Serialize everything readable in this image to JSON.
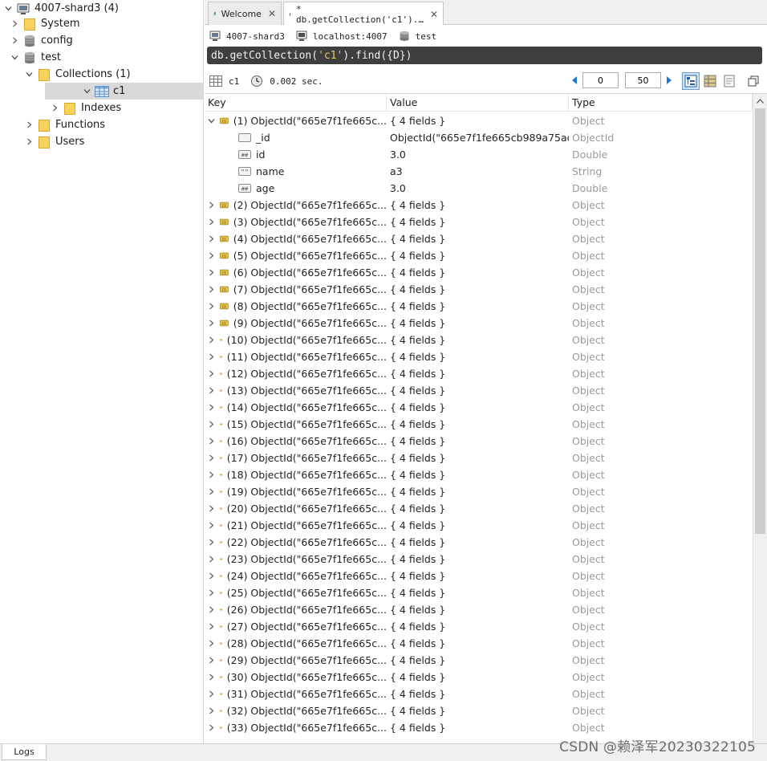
{
  "sidebar": {
    "items": [
      {
        "label": "4007-shard3 (4)",
        "icon": "server-icon",
        "expanded": true,
        "level": 0
      },
      {
        "label": "System",
        "icon": "folder-icon",
        "expanded": false,
        "level": 1
      },
      {
        "label": "config",
        "icon": "database-icon",
        "expanded": false,
        "level": 1
      },
      {
        "label": "test",
        "icon": "database-icon",
        "expanded": true,
        "level": 1
      },
      {
        "label": "Collections (1)",
        "icon": "folder-icon",
        "expanded": true,
        "level": 2
      },
      {
        "label": "c1",
        "icon": "collection-icon",
        "expanded": true,
        "level": 3,
        "selected": true
      },
      {
        "label": "Indexes",
        "icon": "folder-icon",
        "expanded": false,
        "level": 4
      },
      {
        "label": "Functions",
        "icon": "folder-icon",
        "expanded": false,
        "level": 2
      },
      {
        "label": "Users",
        "icon": "folder-icon",
        "expanded": false,
        "level": 2
      }
    ]
  },
  "tabs": [
    {
      "label": "Welcome",
      "active": false
    },
    {
      "label": "* db.getCollection('c1').…",
      "active": true
    }
  ],
  "connection": {
    "server": "4007-shard3",
    "host": "localhost:4007",
    "database": "test"
  },
  "query": {
    "prefix": "db.getCollection(",
    "arg": "'c1'",
    "suffix": ").find({D})"
  },
  "result_toolbar": {
    "collection": "c1",
    "time": "0.002 sec.",
    "skip": "0",
    "limit": "50"
  },
  "grid": {
    "headers": {
      "key": "Key",
      "value": "Value",
      "type": "Type"
    },
    "expanded_doc": {
      "key": "(1) ObjectId(\"665e7f1fe665c...",
      "value": "{ 4 fields }",
      "type": "Object",
      "fields": [
        {
          "key": "_id",
          "value": "ObjectId(\"665e7f1fe665cb989a75ad...",
          "type": "ObjectId",
          "icon": "objectid-icon"
        },
        {
          "key": "id",
          "value": "3.0",
          "type": "Double",
          "icon": "number-icon"
        },
        {
          "key": "name",
          "value": "a3",
          "type": "String",
          "icon": "string-icon"
        },
        {
          "key": "age",
          "value": "3.0",
          "type": "Double",
          "icon": "number-icon"
        }
      ]
    },
    "collapsed_docs": [
      {
        "key": "(2) ObjectId(\"665e7f1fe665c...",
        "value": "{ 4 fields }",
        "type": "Object"
      },
      {
        "key": "(3) ObjectId(\"665e7f1fe665c...",
        "value": "{ 4 fields }",
        "type": "Object"
      },
      {
        "key": "(4) ObjectId(\"665e7f1fe665c...",
        "value": "{ 4 fields }",
        "type": "Object"
      },
      {
        "key": "(5) ObjectId(\"665e7f1fe665c...",
        "value": "{ 4 fields }",
        "type": "Object"
      },
      {
        "key": "(6) ObjectId(\"665e7f1fe665c...",
        "value": "{ 4 fields }",
        "type": "Object"
      },
      {
        "key": "(7) ObjectId(\"665e7f1fe665c...",
        "value": "{ 4 fields }",
        "type": "Object"
      },
      {
        "key": "(8) ObjectId(\"665e7f1fe665c...",
        "value": "{ 4 fields }",
        "type": "Object"
      },
      {
        "key": "(9) ObjectId(\"665e7f1fe665c...",
        "value": "{ 4 fields }",
        "type": "Object"
      },
      {
        "key": "(10) ObjectId(\"665e7f1fe665c...",
        "value": "{ 4 fields }",
        "type": "Object"
      },
      {
        "key": "(11) ObjectId(\"665e7f1fe665c...",
        "value": "{ 4 fields }",
        "type": "Object"
      },
      {
        "key": "(12) ObjectId(\"665e7f1fe665c...",
        "value": "{ 4 fields }",
        "type": "Object"
      },
      {
        "key": "(13) ObjectId(\"665e7f1fe665c...",
        "value": "{ 4 fields }",
        "type": "Object"
      },
      {
        "key": "(14) ObjectId(\"665e7f1fe665c...",
        "value": "{ 4 fields }",
        "type": "Object"
      },
      {
        "key": "(15) ObjectId(\"665e7f1fe665c...",
        "value": "{ 4 fields }",
        "type": "Object"
      },
      {
        "key": "(16) ObjectId(\"665e7f1fe665c...",
        "value": "{ 4 fields }",
        "type": "Object"
      },
      {
        "key": "(17) ObjectId(\"665e7f1fe665c...",
        "value": "{ 4 fields }",
        "type": "Object"
      },
      {
        "key": "(18) ObjectId(\"665e7f1fe665c...",
        "value": "{ 4 fields }",
        "type": "Object"
      },
      {
        "key": "(19) ObjectId(\"665e7f1fe665c...",
        "value": "{ 4 fields }",
        "type": "Object"
      },
      {
        "key": "(20) ObjectId(\"665e7f1fe665c...",
        "value": "{ 4 fields }",
        "type": "Object"
      },
      {
        "key": "(21) ObjectId(\"665e7f1fe665c...",
        "value": "{ 4 fields }",
        "type": "Object"
      },
      {
        "key": "(22) ObjectId(\"665e7f1fe665c...",
        "value": "{ 4 fields }",
        "type": "Object"
      },
      {
        "key": "(23) ObjectId(\"665e7f1fe665c...",
        "value": "{ 4 fields }",
        "type": "Object"
      },
      {
        "key": "(24) ObjectId(\"665e7f1fe665c...",
        "value": "{ 4 fields }",
        "type": "Object"
      },
      {
        "key": "(25) ObjectId(\"665e7f1fe665c...",
        "value": "{ 4 fields }",
        "type": "Object"
      },
      {
        "key": "(26) ObjectId(\"665e7f1fe665c...",
        "value": "{ 4 fields }",
        "type": "Object"
      },
      {
        "key": "(27) ObjectId(\"665e7f1fe665c...",
        "value": "{ 4 fields }",
        "type": "Object"
      },
      {
        "key": "(28) ObjectId(\"665e7f1fe665c...",
        "value": "{ 4 fields }",
        "type": "Object"
      },
      {
        "key": "(29) ObjectId(\"665e7f1fe665c...",
        "value": "{ 4 fields }",
        "type": "Object"
      },
      {
        "key": "(30) ObjectId(\"665e7f1fe665c...",
        "value": "{ 4 fields }",
        "type": "Object"
      },
      {
        "key": "(31) ObjectId(\"665e7f1fe665c...",
        "value": "{ 4 fields }",
        "type": "Object"
      },
      {
        "key": "(32) ObjectId(\"665e7f1fe665c...",
        "value": "{ 4 fields }",
        "type": "Object"
      },
      {
        "key": "(33) ObjectId(\"665e7f1fe665c...",
        "value": "{ 4 fields }",
        "type": "Object"
      }
    ]
  },
  "bottom": {
    "logs_tab": "Logs",
    "watermark": "CSDN @赖泽军20230322105"
  },
  "colors": {
    "accent": "#1e78d2",
    "query_bg": "#3e3e3e",
    "selected_row": "#d9d9d9",
    "folder": "#f5c84a",
    "doc_icon": "#d4b23a"
  }
}
